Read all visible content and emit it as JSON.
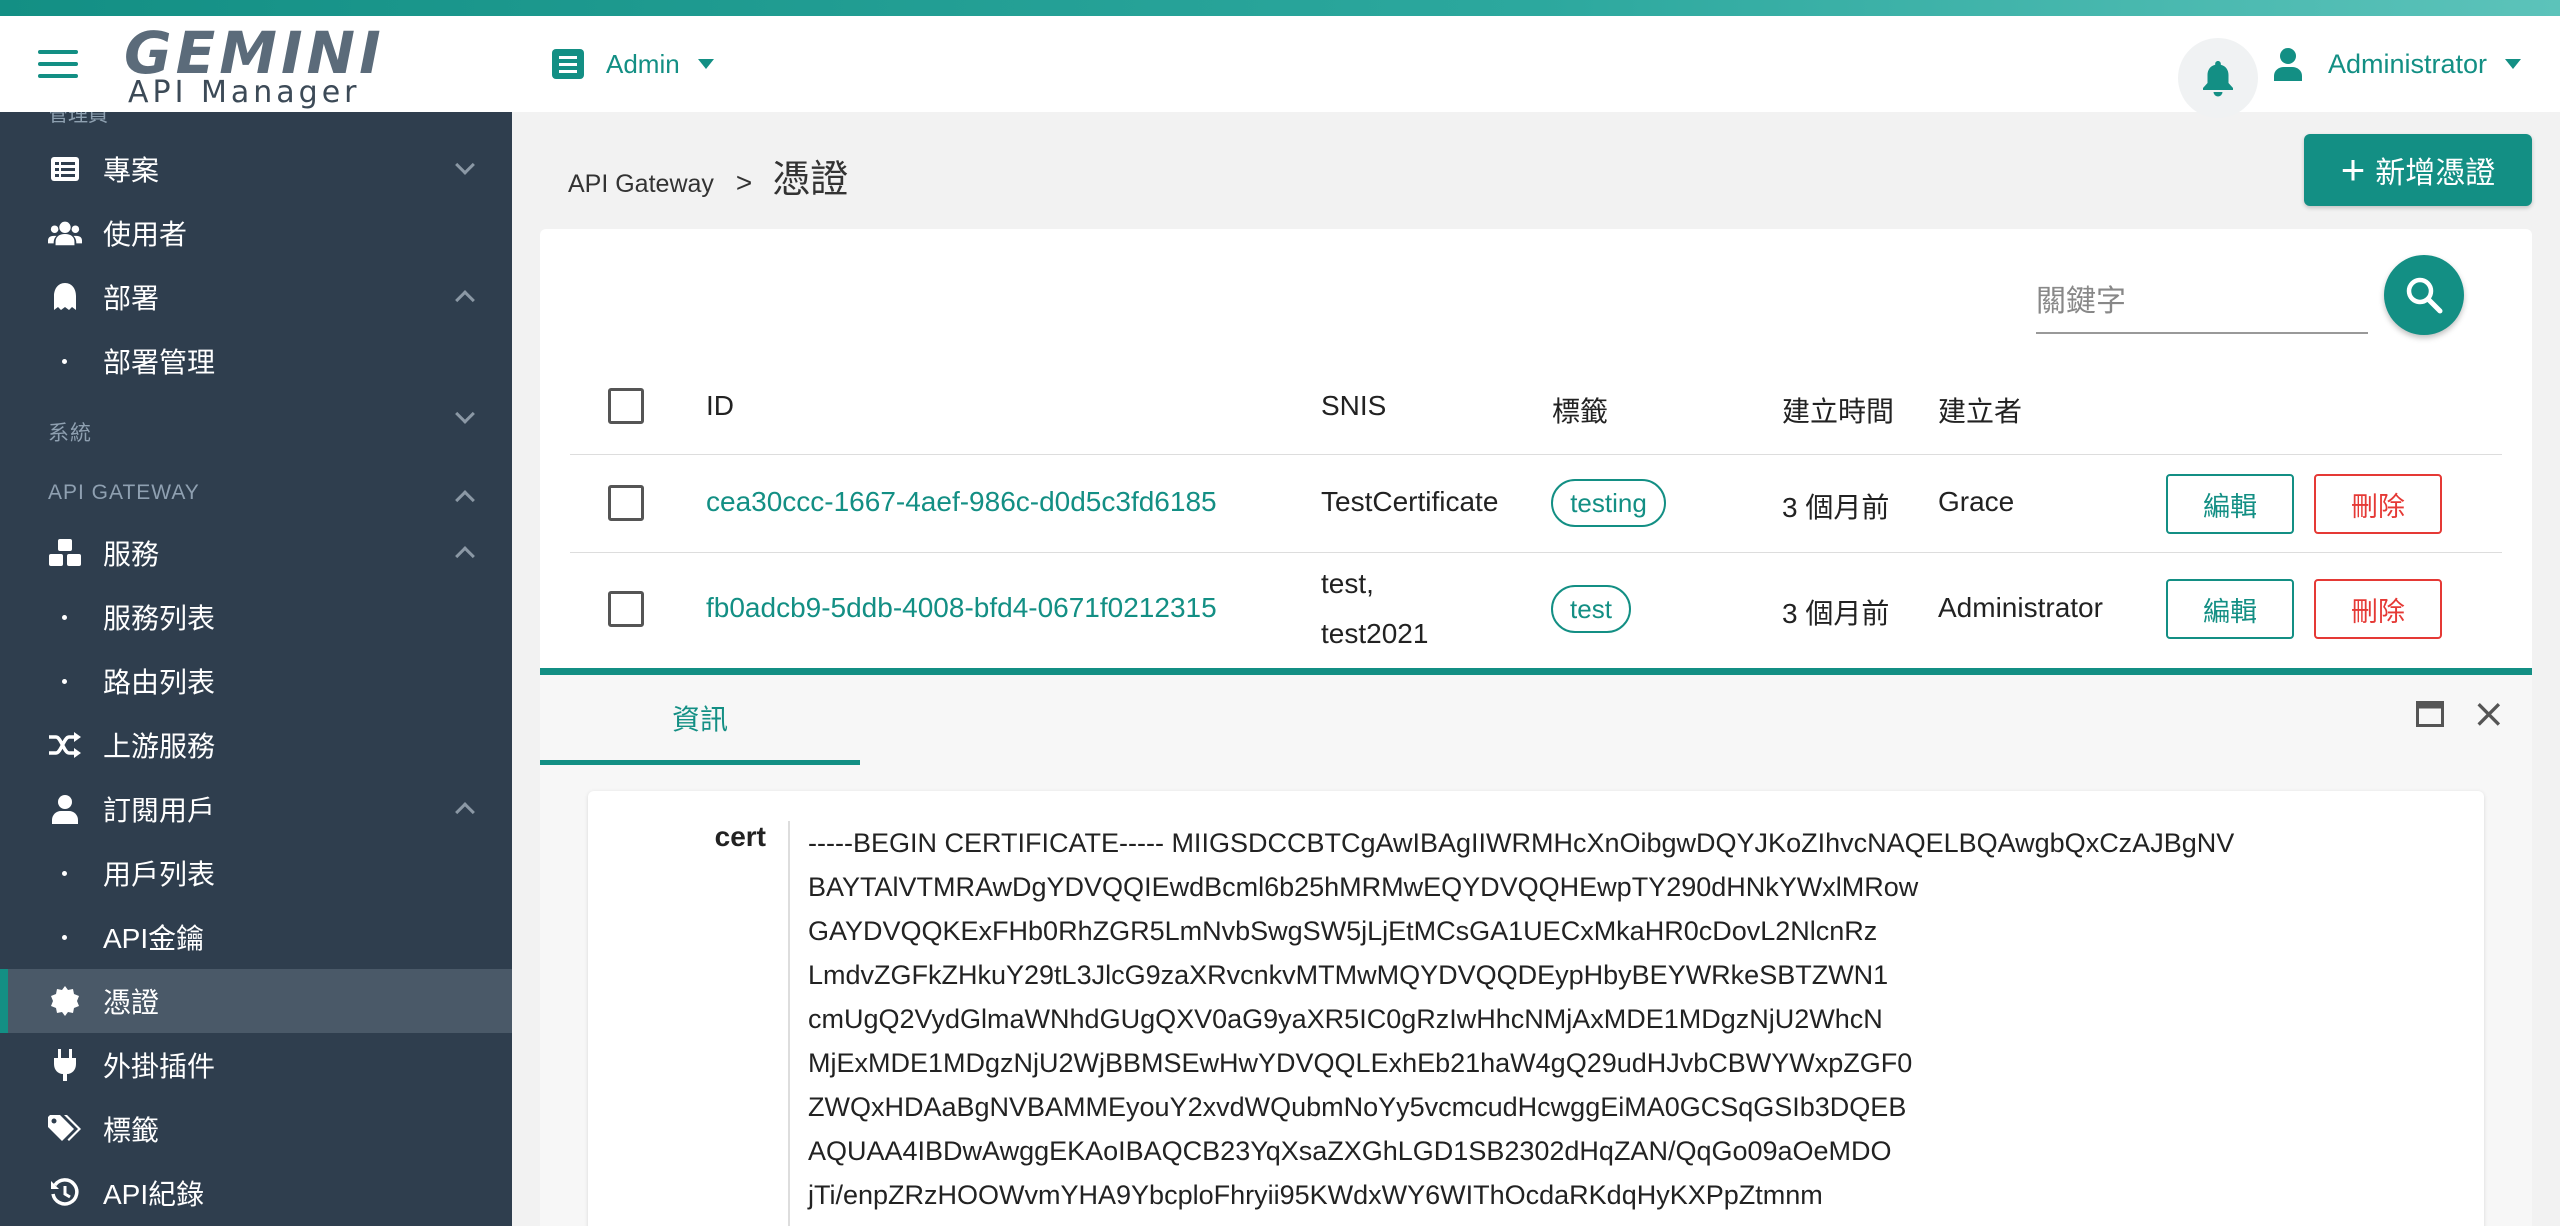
{
  "header": {
    "logo_main": "GEMINI",
    "logo_sub": "API Manager",
    "workspace": "Admin",
    "user": "Administrator"
  },
  "sidebar": {
    "cut_label": "管理員",
    "items": [
      {
        "label": "專案",
        "icon": "list-icon"
      },
      {
        "label": "使用者",
        "icon": "users-icon"
      },
      {
        "label": "部署",
        "icon": "rocket-icon"
      },
      {
        "label": "部署管理"
      },
      {
        "label": "系統"
      },
      {
        "label": "API GATEWAY"
      },
      {
        "label": "服務",
        "icon": "cubes-icon"
      },
      {
        "label": "服務列表"
      },
      {
        "label": "路由列表"
      },
      {
        "label": "上游服務",
        "icon": "shuffle-icon"
      },
      {
        "label": "訂閱用戶",
        "icon": "user-icon"
      },
      {
        "label": "用戶列表"
      },
      {
        "label": "API金鑰"
      },
      {
        "label": "憑證",
        "icon": "certificate-icon"
      },
      {
        "label": "外掛插件",
        "icon": "plug-icon"
      },
      {
        "label": "標籤",
        "icon": "tags-icon"
      },
      {
        "label": "API紀錄",
        "icon": "history-icon"
      }
    ]
  },
  "breadcrumb": {
    "parent": "API Gateway",
    "separator": ">",
    "current": "憑證"
  },
  "new_button": "新增憑證",
  "search": {
    "placeholder": "關鍵字"
  },
  "table": {
    "columns": [
      "ID",
      "SNIS",
      "標籤",
      "建立時間",
      "建立者"
    ],
    "rows": [
      {
        "id": "cea30ccc-1667-4aef-986c-d0d5c3fd6185",
        "snis": [
          "TestCertificate"
        ],
        "tag": "testing",
        "created": "3 個月前",
        "creator": "Grace",
        "edit": "編輯",
        "delete": "刪除"
      },
      {
        "id": "fb0adcb9-5ddb-4008-bfd4-0671f0212315",
        "snis": [
          "test,",
          "test2021"
        ],
        "tag": "test",
        "created": "3 個月前",
        "creator": "Administrator",
        "edit": "編輯",
        "delete": "刪除"
      }
    ]
  },
  "panel": {
    "tab": "資訊",
    "close": "×",
    "detail_key": "cert",
    "cert_lines": [
      "-----BEGIN CERTIFICATE----- MIIGSDCCBTCgAwIBAgIIWRMHcXnOibgwDQYJKoZIhvcNAQELBQAwgbQxCzAJBgNV",
      "BAYTAlVTMRAwDgYDVQQIEwdBcml6b25hMRMwEQYDVQQHEwpTY290dHNkYWxlMRow",
      "GAYDVQQKExFHb0RhZGR5LmNvbSwgSW5jLjEtMCsGA1UECxMkaHR0cDovL2NlcnRz",
      "LmdvZGFkZHkuY29tL3JlcG9zaXRvcnkvMTMwMQYDVQQDEypHbyBEYWRkeSBTZWN1",
      "cmUgQ2VydGlmaWNhdGUgQXV0aG9yaXR5IC0gRzIwHhcNMjAxMDE1MDgzNjU2WhcN",
      "MjExMDE1MDgzNjU2WjBBMSEwHwYDVQQLExhEb21haW4gQ29udHJvbCBWYWxpZGF0",
      "ZWQxHDAaBgNVBAMMEyouY2xvdWQubmNoYy5vcmcudHcwggEiMA0GCSqGSIb3DQEB",
      "AQUAA4IBDwAwggEKAoIBAQCB23YqXsaZXGhLGD1SB2302dHqZAN/QqGo09aOeMDO",
      "jTi/enpZRzHOOWvmYHA9YbcploFhryii95KWdxWY6WIThOcdaRKdqHyKXPpZtmnm"
    ]
  },
  "colors": {
    "accent": "#138f84",
    "sidebar": "#2f3e4e",
    "danger": "#e53935"
  }
}
